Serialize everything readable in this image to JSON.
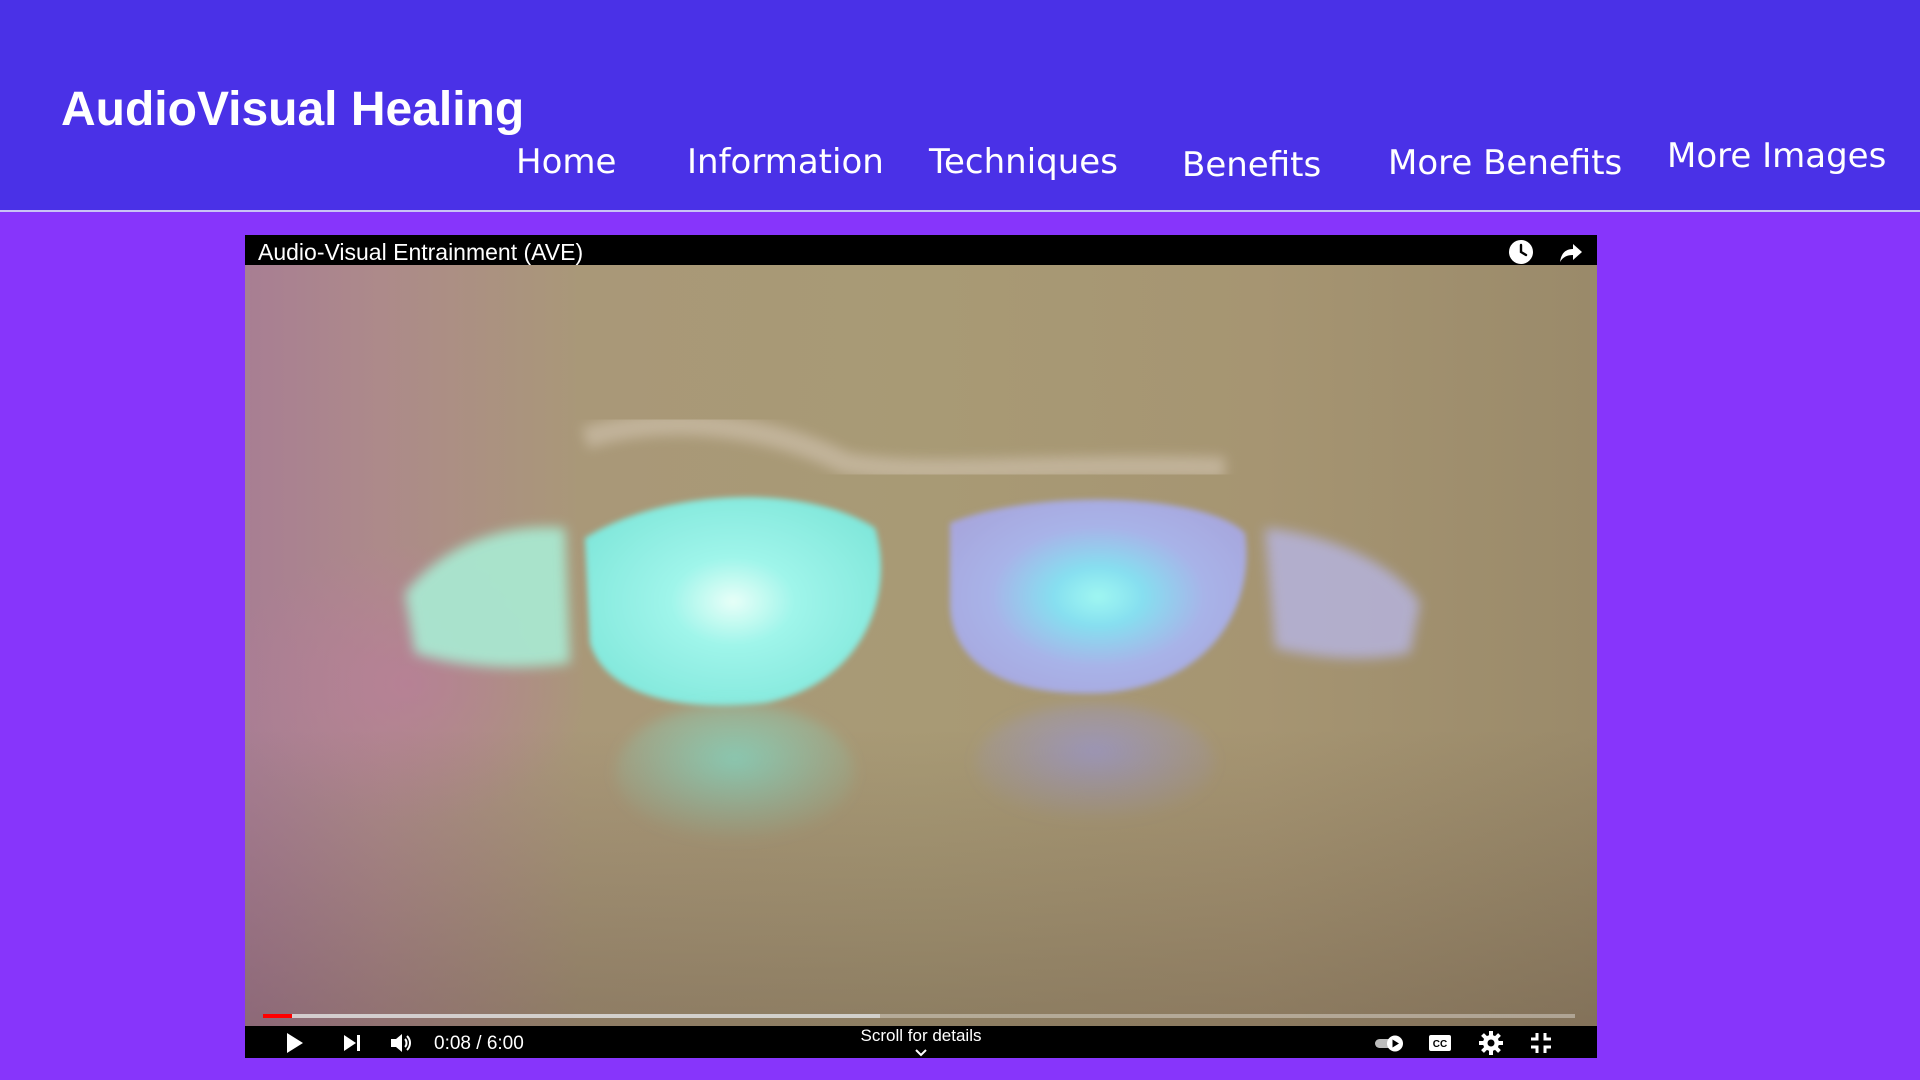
{
  "site": {
    "title": "AudioVisual Healing"
  },
  "nav": {
    "items": [
      {
        "label": "Home"
      },
      {
        "label": "Information"
      },
      {
        "label": "Techniques"
      },
      {
        "label": "Benefits"
      },
      {
        "label": "More Benefits"
      },
      {
        "label": "More Images"
      }
    ]
  },
  "video": {
    "title": "Audio-Visual Entrainment (AVE)",
    "time_display": "0:08 / 6:00",
    "played_fraction": 0.022,
    "buffered_fraction": 0.47,
    "scroll_hint": "Scroll for details",
    "top_icons": [
      "watch-later-icon",
      "share-icon"
    ],
    "control_icons": [
      "play-icon",
      "next-icon",
      "volume-icon",
      "autoplay-toggle-icon",
      "captions-icon",
      "settings-icon",
      "exit-fullscreen-icon"
    ]
  },
  "colors": {
    "header_bg": "#4a31e7",
    "page_bg": "#8735fb",
    "progress_played": "#ff0000"
  }
}
